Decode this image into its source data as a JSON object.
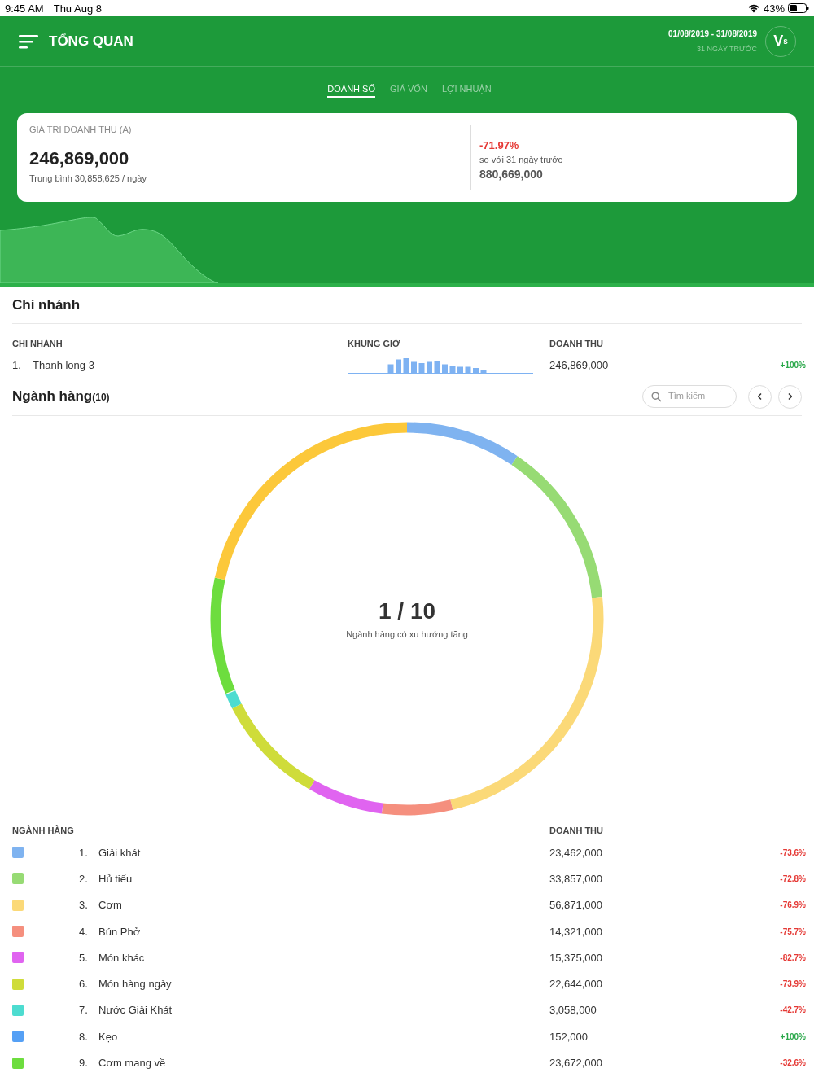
{
  "status_bar": {
    "time": "9:45 AM",
    "date": "Thu Aug 8",
    "battery": "43%"
  },
  "header": {
    "title": "TỔNG QUAN",
    "date_range": "01/08/2019 - 31/08/2019",
    "period": "31 NGÀY TRƯỚC",
    "avatar": "V",
    "avatar_sub": "s"
  },
  "tabs": [
    {
      "label": "DOANH SỐ",
      "selected": true
    },
    {
      "label": "GIÁ VỐN",
      "selected": false
    },
    {
      "label": "LỢI NHUẬN",
      "selected": false
    }
  ],
  "summary": {
    "label": "GIÁ TRỊ DOANH THU (A)",
    "value": "246,869,000",
    "average": "Trung bình 30,858,625 / ngày",
    "change": "-71.97%",
    "compare_label": "so với 31 ngày trước",
    "previous": "880,669,000"
  },
  "branches": {
    "title": "Chi nhánh",
    "columns": [
      "CHI NHÁNH",
      "KHUNG GIỜ",
      "DOANH THU"
    ],
    "rows": [
      {
        "index": "1.",
        "name": "Thanh long 3",
        "revenue": "246,869,000",
        "change": "+100%"
      }
    ]
  },
  "categories": {
    "title": "Ngành hàng",
    "count": "(10)",
    "search_placeholder": "Tìm kiếm",
    "center_value": "1 / 10",
    "center_label": "Ngành hàng có xu hướng tăng",
    "other_segment": {
      "color": "#fcc83a"
    },
    "columns": [
      "NGÀNH HÀNG",
      "DOANH THU"
    ],
    "rows": [
      {
        "index": "1.",
        "name": "Giải khát",
        "revenue": "23,462,000",
        "change": "-73.6%",
        "color": "#7fb3f0"
      },
      {
        "index": "2.",
        "name": "Hủ tiếu",
        "revenue": "33,857,000",
        "change": "-72.8%",
        "color": "#97db74"
      },
      {
        "index": "3.",
        "name": "Cơm",
        "revenue": "56,871,000",
        "change": "-76.9%",
        "color": "#fbd978"
      },
      {
        "index": "4.",
        "name": "Bún Phở",
        "revenue": "14,321,000",
        "change": "-75.7%",
        "color": "#f58f7e"
      },
      {
        "index": "5.",
        "name": "Món khác",
        "revenue": "15,375,000",
        "change": "-82.7%",
        "color": "#e064f0"
      },
      {
        "index": "6.",
        "name": "Món hàng ngày",
        "revenue": "22,644,000",
        "change": "-73.9%",
        "color": "#cfdc3a"
      },
      {
        "index": "7.",
        "name": "Nước Giải Khát",
        "revenue": "3,058,000",
        "change": "-42.7%",
        "color": "#4ddcd0"
      },
      {
        "index": "8.",
        "name": "Kẹo",
        "revenue": "152,000",
        "change": "+100%",
        "color": "#55a0f5"
      },
      {
        "index": "9.",
        "name": "Cơm mang về",
        "revenue": "23,672,000",
        "change": "-32.6%",
        "color": "#6ddd3e"
      }
    ]
  }
}
